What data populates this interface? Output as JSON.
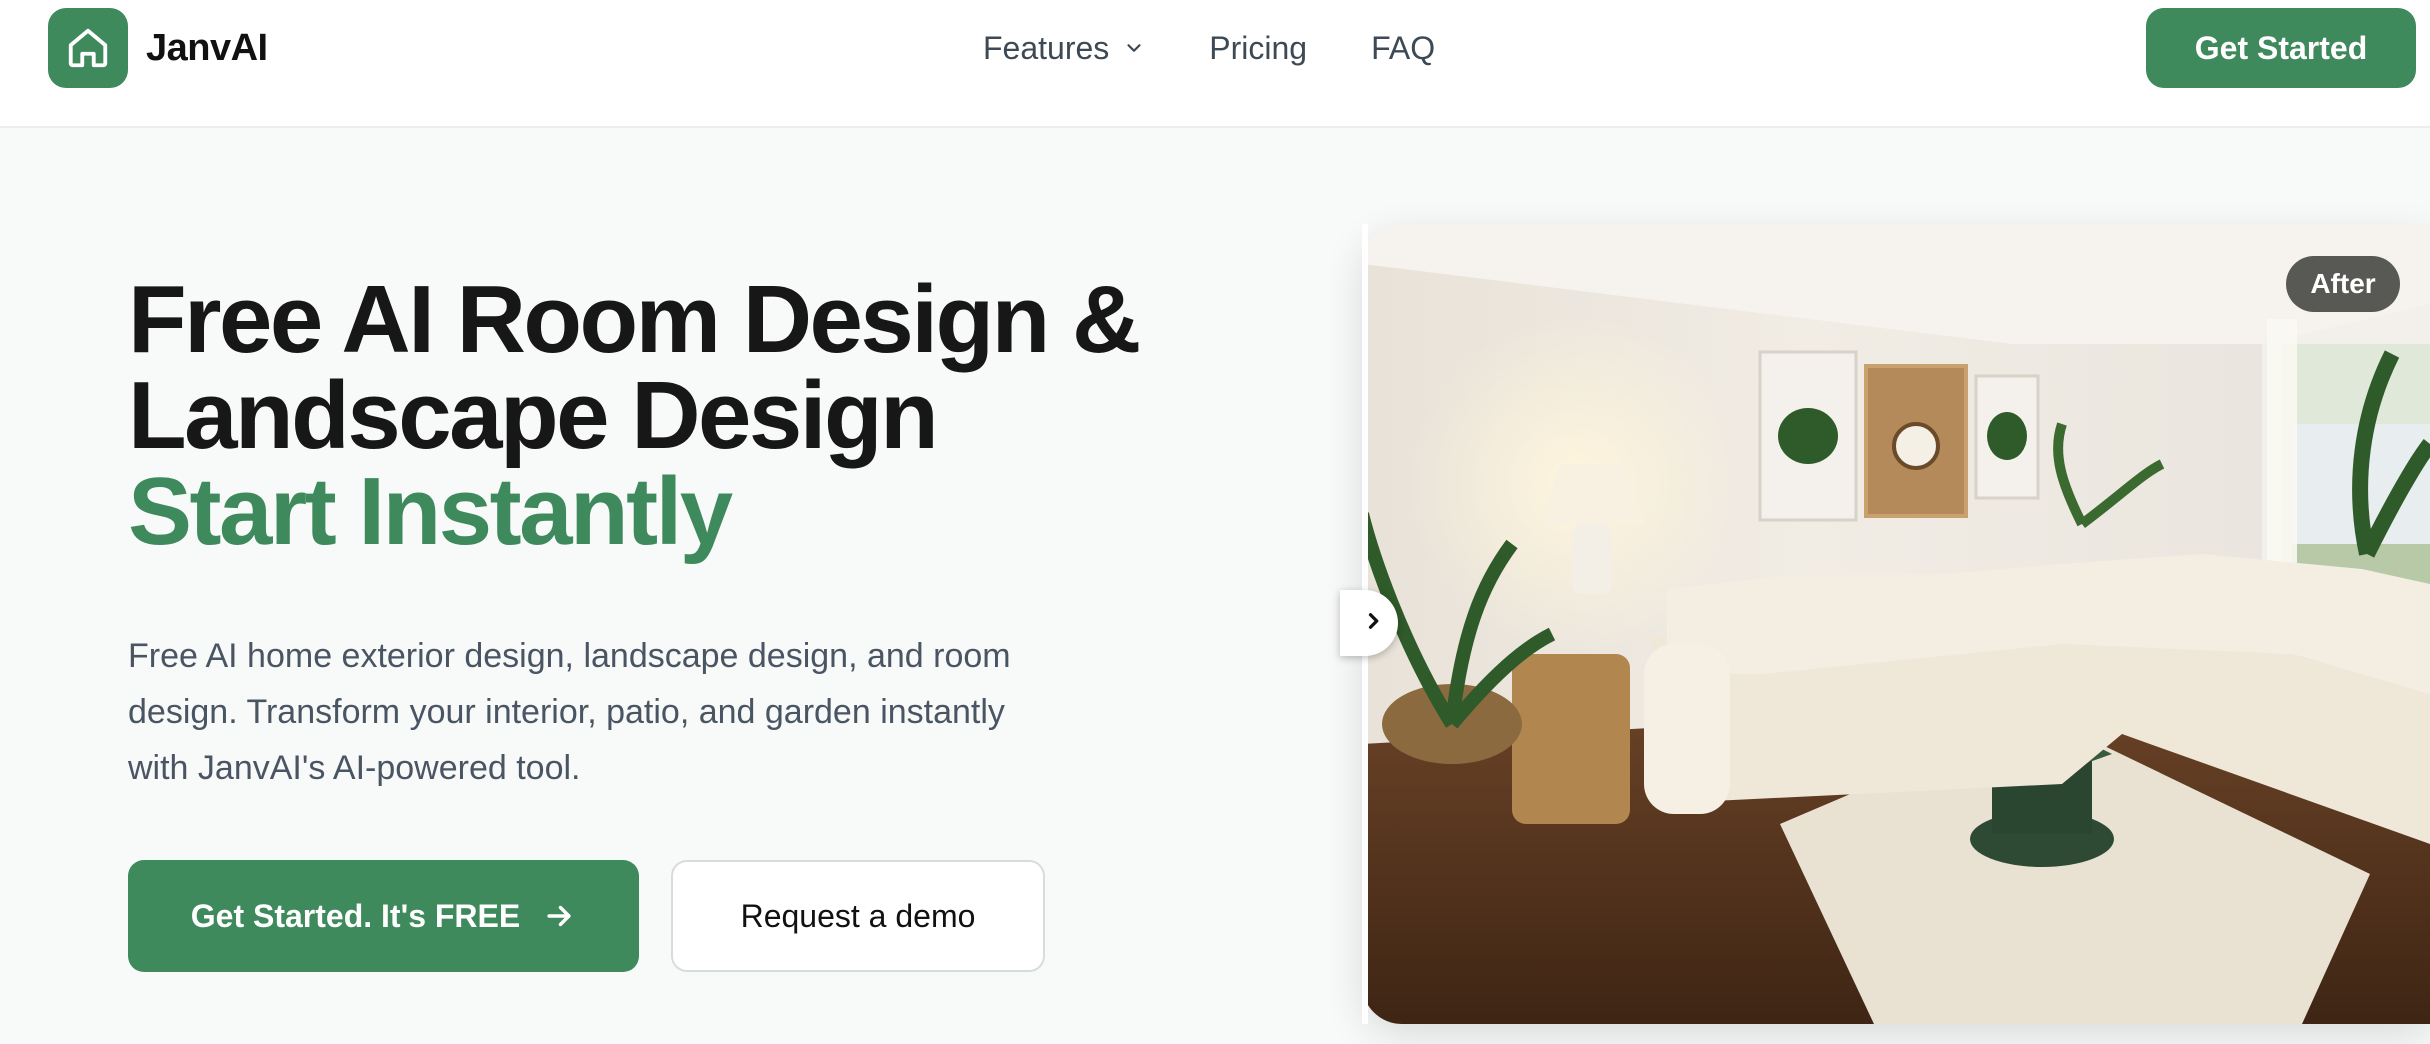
{
  "brand": {
    "name": "JanvAI",
    "logo_icon": "home-icon",
    "accent_color": "#3f8a5c"
  },
  "nav": {
    "items": [
      {
        "label": "Features",
        "has_dropdown": true,
        "icon": "chevron-down-icon"
      },
      {
        "label": "Pricing"
      },
      {
        "label": "FAQ"
      }
    ],
    "cta_label": "Get Started"
  },
  "hero": {
    "title_line1": "Free AI Room Design &",
    "title_line2": "Landscape Design",
    "title_accent": "Start Instantly",
    "description": "Free AI home exterior design, landscape design, and room design. Transform your interior, patio, and garden instantly with JanvAI's AI-powered tool.",
    "primary_cta": "Get Started. It's FREE",
    "primary_cta_icon": "arrow-right-icon",
    "secondary_cta": "Request a demo"
  },
  "comparison": {
    "badge": "After",
    "handle_icon": "chevron-left-right-icon",
    "image_subject": "living-room-after-render"
  }
}
